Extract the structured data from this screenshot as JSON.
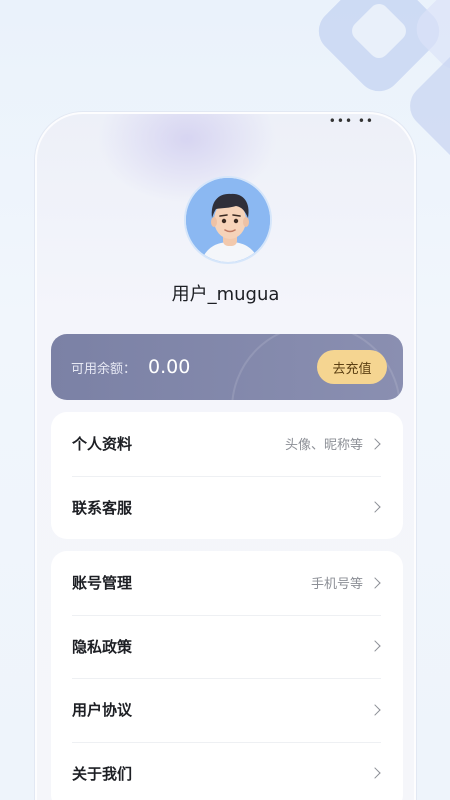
{
  "status": {
    "indicators": "••• ••"
  },
  "profile": {
    "username": "用户_mugua"
  },
  "balance": {
    "label": "可用余额：",
    "amount": "0.00",
    "recharge_label": "去充值"
  },
  "menu_group_1": [
    {
      "title": "个人资料",
      "hint": "头像、昵称等"
    },
    {
      "title": "联系客服",
      "hint": ""
    }
  ],
  "menu_group_2": [
    {
      "title": "账号管理",
      "hint": "手机号等"
    },
    {
      "title": "隐私政策",
      "hint": ""
    },
    {
      "title": "用户协议",
      "hint": ""
    },
    {
      "title": "关于我们",
      "hint": ""
    }
  ],
  "colors": {
    "balance_card": "#7b81a5",
    "recharge_button": "#f5d591",
    "avatar_bg": "#8bb8f2"
  },
  "icons": {
    "row_arrow": "chevron-right-icon"
  }
}
